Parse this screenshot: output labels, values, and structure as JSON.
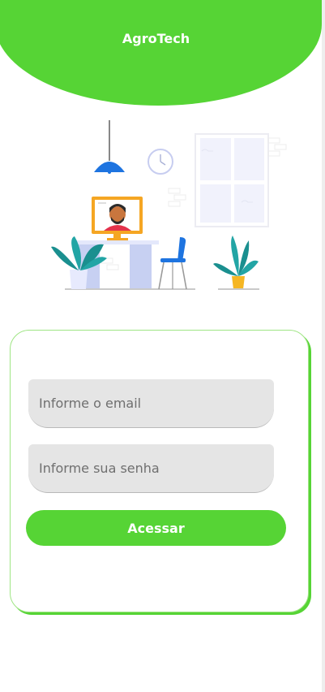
{
  "app": {
    "title": "AgroTech"
  },
  "login": {
    "email_placeholder": "Informe o email",
    "email_value": "",
    "password_placeholder": "Informe sua senha",
    "password_value": "",
    "submit_label": "Acessar"
  },
  "colors": {
    "brand_green": "#56d435",
    "input_bg": "#e5e5e5",
    "card_border": "#9fe584"
  },
  "illustration": {
    "description": "home-office-icon"
  }
}
